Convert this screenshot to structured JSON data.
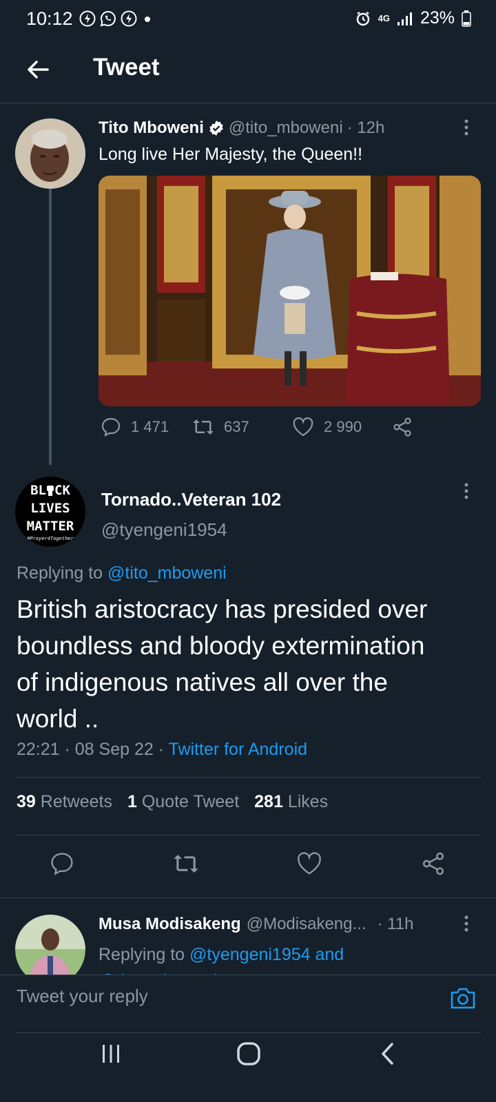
{
  "status_bar": {
    "time": "10:12",
    "network": "4G",
    "battery": "23%"
  },
  "header": {
    "title": "Tweet"
  },
  "parent_tweet": {
    "name": "Tito Mboweni",
    "handle": "@tito_mboweni",
    "time": "· 12h",
    "text": "Long live Her Majesty, the Queen!!",
    "replies": "1 471",
    "retweets": "637",
    "likes": "2 990"
  },
  "main_tweet": {
    "avatar_text": [
      "BL",
      "CK",
      "LIVES",
      "MATTER",
      "#Prayer4Together"
    ],
    "name": "Tornado..Veteran 102",
    "handle": "@tyengeni1954",
    "replying_prefix": "Replying to",
    "replying_to": "@tito_mboweni",
    "text_lines": [
      "British aristocracy has presided over",
      "boundless and bloody extermination",
      "of indigenous natives all over the",
      "world .."
    ],
    "timestamp": "22:21 · 08 Sep 22 ·",
    "source": "Twitter for Android",
    "retweets_count": "39",
    "retweets_label": "Retweets",
    "quotes_count": "1",
    "quotes_label": "Quote Tweet",
    "likes_count": "281",
    "likes_label": "Likes"
  },
  "reply_tweet": {
    "name": "Musa Modisakeng",
    "handle": "@Modisakeng...",
    "time": "· 11h",
    "replying_prefix": "Replying to",
    "replying_to": "@tyengeni1954 and",
    "replying_to_more": "@tito_mboweni"
  },
  "reply_input": {
    "placeholder": "Tweet your reply"
  },
  "colors": {
    "background": "#15202b",
    "accent": "#1d9bf0",
    "muted": "#8b98a5",
    "divider": "#38444d"
  }
}
